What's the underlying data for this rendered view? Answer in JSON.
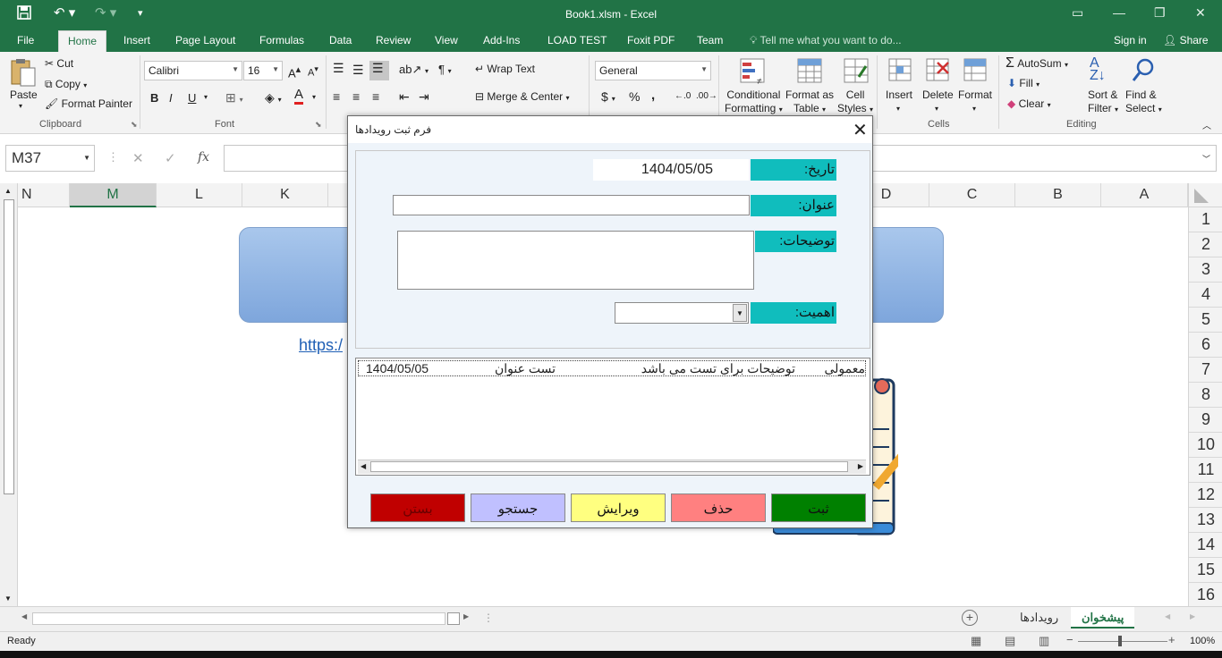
{
  "window": {
    "title": "Book1.xlsm - Excel"
  },
  "tabs": [
    "File",
    "Home",
    "Insert",
    "Page Layout",
    "Formulas",
    "Data",
    "Review",
    "View",
    "Add-Ins",
    "LOAD TEST",
    "Foxit PDF",
    "Team"
  ],
  "tell_me": "Tell me what you want to do...",
  "signin": "Sign in",
  "share": "Share",
  "ribbon": {
    "paste": "Paste",
    "cut": "Cut",
    "copy": "Copy",
    "format_painter": "Format Painter",
    "clipboard": "Clipboard",
    "font_name": "Calibri",
    "font_size": "16",
    "font_group": "Font",
    "bold": "B",
    "italic": "I",
    "underline": "U",
    "wrap_text": "Wrap Text",
    "merge_center": "Merge & Center",
    "number_format": "General",
    "currency": "$",
    "percent": "%",
    "comma": ",",
    "cond_formatting_1": "Conditional",
    "cond_formatting_2": "Formatting",
    "format_table_1": "Format as",
    "format_table_2": "Table",
    "cell_styles_1": "Cell",
    "cell_styles_2": "Styles",
    "insert": "Insert",
    "delete": "Delete",
    "format": "Format",
    "cells": "Cells",
    "autosum": "AutoSum",
    "fill": "Fill",
    "clear": "Clear",
    "sort_filter_1": "Sort &",
    "sort_filter_2": "Filter",
    "find_select_1": "Find &",
    "find_select_2": "Select",
    "editing": "Editing"
  },
  "namebox": "M37",
  "fx_label": "fx",
  "columns": [
    "N",
    "M",
    "L",
    "K",
    "D",
    "C",
    "B",
    "A"
  ],
  "rows": [
    "1",
    "2",
    "3",
    "4",
    "5",
    "6",
    "7",
    "8",
    "9",
    "10",
    "11",
    "12",
    "13",
    "14",
    "15",
    "16"
  ],
  "sheet": {
    "link": "https:/"
  },
  "sheet_tabs": [
    "پیشخوان",
    "رویدادها"
  ],
  "status": {
    "ready": "Ready",
    "zoom": "100%"
  },
  "dialog": {
    "title": "فرم ثبت رویدادها",
    "close": "✕",
    "label_date": "تاریخ:",
    "label_title": "عنوان:",
    "label_desc": "توضیحات:",
    "label_importance": "اهمیت:",
    "date_value": "1404/05/05",
    "list_row": {
      "importance": "معمولی",
      "desc": "توضیحات برای تست می باشد",
      "title": "تست عنوان",
      "date": "1404/05/05"
    },
    "buttons": {
      "submit": "ثبت",
      "delete": "حذف",
      "edit": "ویرایش",
      "search": "جستجو",
      "close": "بستن"
    }
  },
  "colors": {
    "excel_green": "#217346",
    "label_teal": "#10bdbd",
    "btn_green": "#008000",
    "btn_red": "#ff8080",
    "btn_yellow": "#ffff80",
    "btn_lavender": "#c0c0ff",
    "btn_darkred": "#c00000"
  }
}
